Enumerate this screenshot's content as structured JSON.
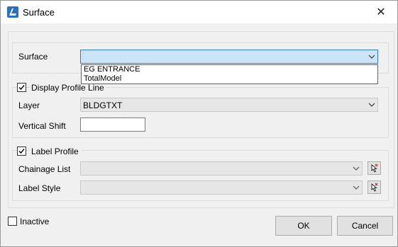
{
  "window": {
    "title": "Surface",
    "close_glyph": "✕"
  },
  "surface": {
    "label": "Surface",
    "value": "",
    "options": [
      "EG ENTRANCE",
      "TotalModel"
    ]
  },
  "display_profile_line": {
    "label": "Display Profile Line",
    "checked": true
  },
  "layer": {
    "label": "Layer",
    "value": "BLDGTXT"
  },
  "vertical_shift": {
    "label": "Vertical Shift",
    "value": ""
  },
  "label_profile": {
    "label": "Label Profile",
    "checked": true
  },
  "chainage_list": {
    "label": "Chainage List",
    "value": ""
  },
  "label_style": {
    "label": "Label Style",
    "value": ""
  },
  "inactive": {
    "label": "Inactive",
    "checked": false
  },
  "buttons": {
    "ok": "OK",
    "cancel": "Cancel"
  },
  "colors": {
    "focus": "#cce4f7",
    "accent": "#2f7ed8"
  }
}
